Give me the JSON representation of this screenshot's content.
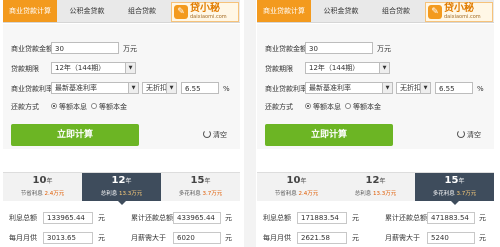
{
  "tabs": [
    "商业贷款计算",
    "公积金贷款",
    "组合贷款"
  ],
  "logo": {
    "text": "贷小秘",
    "sub": "daixiaomi.com",
    "icon": "logo-icon"
  },
  "form": {
    "amount_label": "商业贷款金额",
    "term_label": "贷款期限",
    "rate_label": "商业贷款利率",
    "repay_label": "还款方式",
    "amount_unit": "万元",
    "rate_unit": "%",
    "rate_type": "最新基准利率",
    "discount": "无折扣",
    "option_equal_interest": "等额本息",
    "option_equal_principal": "等额本金",
    "calc_button": "立即计算",
    "clear_button": "清空"
  },
  "panels": [
    {
      "amount": "30",
      "term": "12年（144期）",
      "rate": "6.55",
      "selected_term": 1,
      "terms": [
        {
          "year": "10",
          "unit": "年",
          "label": "节省利息",
          "value": "2.4万元"
        },
        {
          "year": "12",
          "unit": "年",
          "label": "总利息",
          "value": "13.3万元"
        },
        {
          "year": "15",
          "unit": "年",
          "label": "多花利息",
          "value": "3.7万元"
        }
      ],
      "results": {
        "interest_label": "利息总额",
        "interest": "133965.44",
        "interest_unit": "元",
        "total_label": "累计还款总额",
        "total": "433965.44",
        "total_unit": "元",
        "monthly_label": "每月月供",
        "monthly": "3013.65",
        "monthly_unit": "元",
        "income_label": "月薪需大于",
        "income": "6020",
        "income_unit": "元"
      }
    },
    {
      "amount": "30",
      "term": "12年（144期）",
      "rate": "6.55",
      "selected_term": 2,
      "terms": [
        {
          "year": "10",
          "unit": "年",
          "label": "节省利息",
          "value": "2.4万元"
        },
        {
          "year": "12",
          "unit": "年",
          "label": "总利息",
          "value": "13.3万元"
        },
        {
          "year": "15",
          "unit": "年",
          "label": "多花利息",
          "value": "3.7万元"
        }
      ],
      "results": {
        "interest_label": "利息总额",
        "interest": "171883.54",
        "interest_unit": "元",
        "total_label": "累计还款总额",
        "total": "471883.54",
        "total_unit": "元",
        "monthly_label": "每月月供",
        "monthly": "2621.58",
        "monthly_unit": "元",
        "income_label": "月薪需大于",
        "income": "5240",
        "income_unit": "元"
      }
    }
  ]
}
